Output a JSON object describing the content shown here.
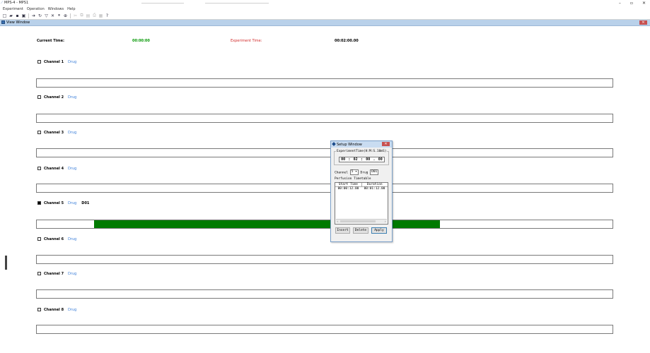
{
  "app": {
    "title": "MPS-4 - MPS1",
    "window_controls": [
      "–",
      "▫",
      "✕"
    ]
  },
  "menu": [
    "Experiment",
    "Operation",
    "Windows",
    "Help"
  ],
  "mdi": {
    "title": "View Window"
  },
  "times": {
    "current_label": "Current Time:",
    "current_value": "00:00:00",
    "experiment_label": "Experiment Time:",
    "experiment_value": "00:02:00.00"
  },
  "channels": [
    {
      "label": "Channel 1",
      "drug": "Drug",
      "checked": false,
      "value": ""
    },
    {
      "label": "Channel 2",
      "drug": "Drug",
      "checked": false,
      "value": ""
    },
    {
      "label": "Channel 3",
      "drug": "Drug",
      "checked": false,
      "value": ""
    },
    {
      "label": "Channel 4",
      "drug": "Drug",
      "checked": false,
      "value": ""
    },
    {
      "label": "Channel 5",
      "drug": "Drug",
      "checked": true,
      "value": "D01"
    },
    {
      "label": "Channel 6",
      "drug": "Drug",
      "checked": false,
      "value": ""
    },
    {
      "label": "Channel 7",
      "drug": "Drug",
      "checked": false,
      "value": ""
    },
    {
      "label": "Channel 8",
      "drug": "Drug",
      "checked": false,
      "value": ""
    }
  ],
  "timeline_fill": {
    "start_fraction": 0.1,
    "end_fraction": 0.7,
    "color": "#007a00"
  },
  "setup": {
    "title": "Setup Window",
    "exp_group_label": "ExperimentTime(H:M:S.10mS)",
    "exp_time": [
      "00",
      "02",
      "00",
      "00"
    ],
    "channel_label": "Channel",
    "channel_value": "5",
    "drug_label": "Drug",
    "drug_value": "D01",
    "perfusion_label": "Perfusion Timetable",
    "columns": [
      "Start Time",
      "Duration"
    ],
    "rows": [
      [
        "00:00:12.00",
        "00:01:12.00"
      ]
    ],
    "buttons": {
      "insert": "Insert",
      "delete": "Delete",
      "apply": "Apply"
    }
  },
  "colors": {
    "current_value": "#0a9a0a",
    "experiment_label": "#d22b2b",
    "drug_link": "#3c7fd9"
  }
}
